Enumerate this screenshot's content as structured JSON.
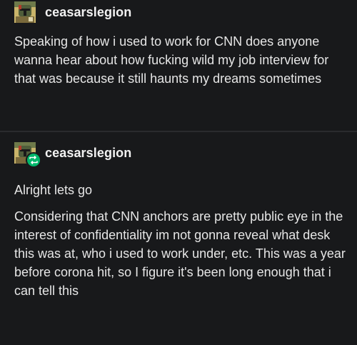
{
  "post1": {
    "username": "ceasarslegion",
    "avatar": "boba-fett-avatar-icon",
    "text": "Speaking of how i used to work for CNN does anyone wanna hear about how fucking wild my job interview for that was because it still haunts my dreams sometimes"
  },
  "post2": {
    "username": "ceasarslegion",
    "avatar": "boba-fett-avatar-icon",
    "badge": "reblog-icon",
    "paragraphs": [
      "Alright lets go",
      "Considering that CNN anchors are pretty public eye in the interest of confidentiality im not gonna reveal what desk this was at, who i used to work under, etc. This was a year before corona hit, so I figure it's been long enough that i can tell this"
    ]
  },
  "colors": {
    "background": "#18191b",
    "text": "#e6e6e6",
    "reblog_badge": "#00b76b"
  }
}
